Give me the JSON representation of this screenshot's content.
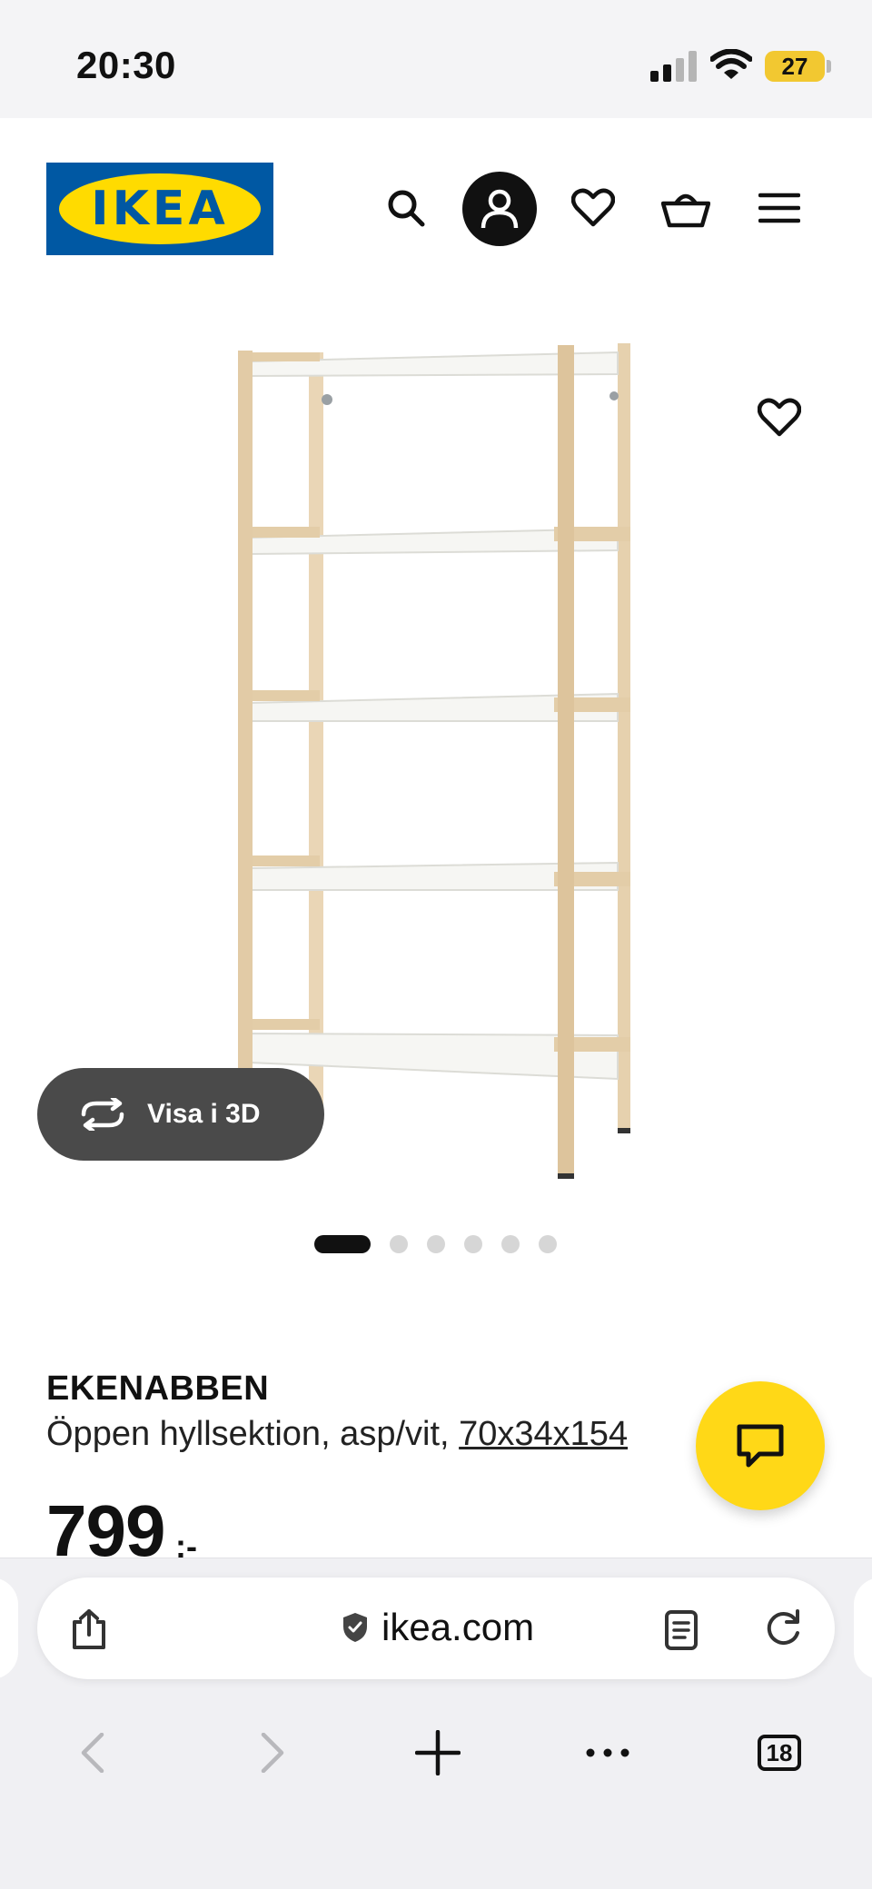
{
  "status_bar": {
    "time": "20:30",
    "battery": "27",
    "signal_icon": "cellular-signal-icon",
    "wifi_icon": "wifi-icon"
  },
  "header": {
    "logo_text": "IKEA",
    "icons": [
      "search-icon",
      "account-icon",
      "heart-icon",
      "basket-icon",
      "menu-icon"
    ],
    "colors": {
      "brand_blue": "#0058a3",
      "brand_yellow": "#ffdb00"
    }
  },
  "gallery": {
    "view_3d_label": "Visa i 3D",
    "image_count": 6,
    "active_image": 1
  },
  "product": {
    "name": "EKENABBEN",
    "description": "Öppen hyllsektion, asp/vit, ",
    "dimensions": "70x34x154",
    "price": "799",
    "price_suffix": ":-"
  },
  "chat": {
    "icon": "chat-bubble-icon",
    "color": "#ffd817"
  },
  "browser": {
    "domain": "ikea.com",
    "tabs_count": "18",
    "icons": [
      "share-icon",
      "shield-icon",
      "reader-icon",
      "reload-icon",
      "back-icon",
      "forward-icon",
      "new-tab-icon",
      "more-icon",
      "tabs-icon"
    ]
  }
}
